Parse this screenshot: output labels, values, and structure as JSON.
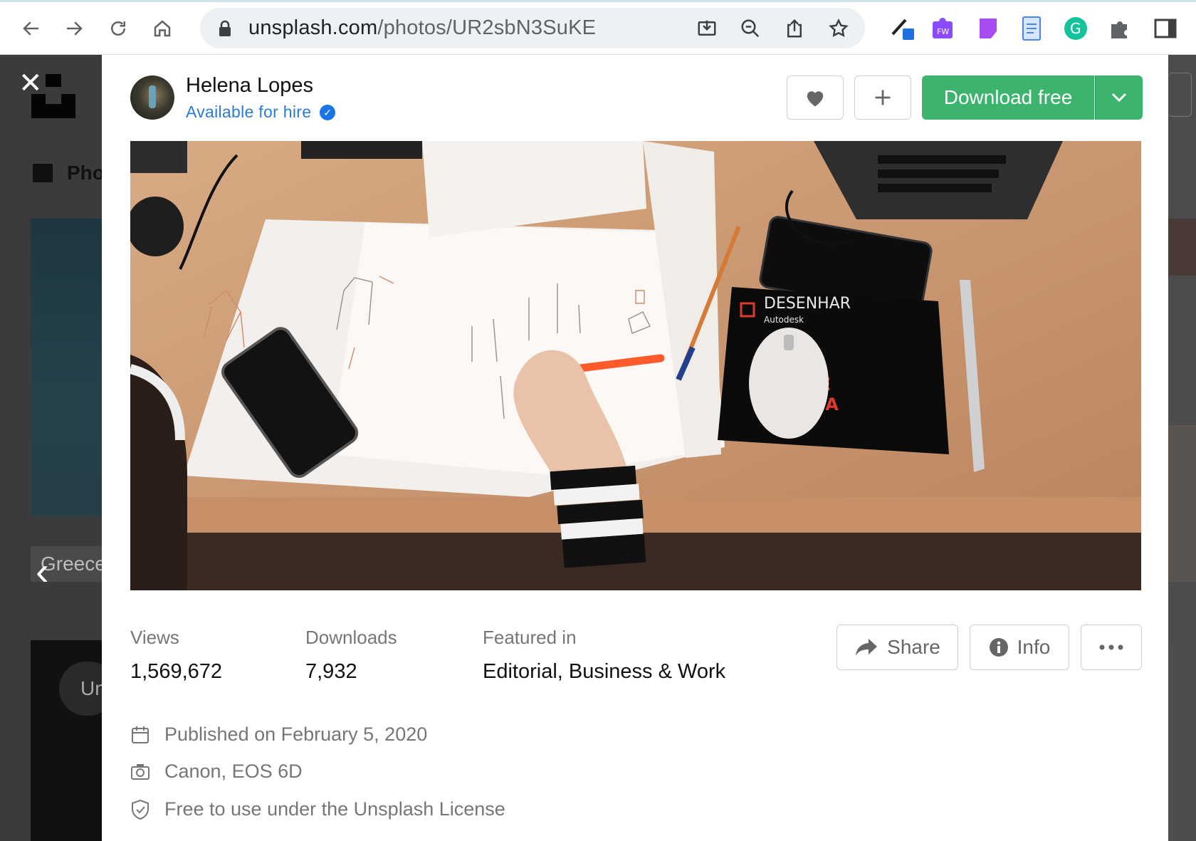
{
  "browser": {
    "url_domain": "unsplash.com",
    "url_path": "/photos/UR2sbN3SuKE"
  },
  "background_page": {
    "photos_tab_label": "Pho",
    "thumb_caption": "Greece",
    "card_label": "Un"
  },
  "modal": {
    "author": {
      "name": "Helena Lopes",
      "hire_label": "Available for hire"
    },
    "download_label": "Download free",
    "stats": [
      {
        "label": "Views",
        "value": "1,569,672"
      },
      {
        "label": "Downloads",
        "value": "7,932"
      },
      {
        "label": "Featured in",
        "value": "Editorial, Business & Work"
      }
    ],
    "actions": {
      "share_label": "Share",
      "info_label": "Info"
    },
    "meta": {
      "published": "Published on February 5, 2020",
      "camera": "Canon, EOS 6D",
      "license": "Free to use under the Unsplash License"
    },
    "photo_subject": "Desk with sketches, phone, pencil and mouse pad",
    "mousepad_text": {
      "title": "DESENHAR",
      "brand": "Autodesk"
    }
  },
  "colors": {
    "download_green": "#3cb46e",
    "hire_blue": "#2a7bd8",
    "overlay": "#3b3b3b"
  }
}
